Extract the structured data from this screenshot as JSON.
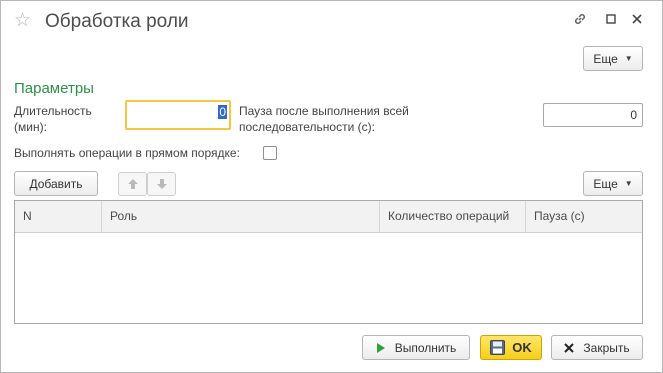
{
  "window": {
    "title": "Обработка роли",
    "icons": [
      "star-icon",
      "link-icon",
      "maximize-icon",
      "close-icon"
    ]
  },
  "toolbar": {
    "more_label": "Еще"
  },
  "params": {
    "section_title": "Параметры",
    "duration_label": "Длительность (мин):",
    "duration_value": "0",
    "pause_label": "Пауза после выполнения всей последовательности (с):",
    "pause_value": "0",
    "order_label": "Выполнять операции в прямом порядке:",
    "order_checked": false
  },
  "list_toolbar": {
    "add_label": "Добавить",
    "move_up_icon": "arrow-up-icon",
    "move_down_icon": "arrow-down-icon",
    "more_label": "Еще"
  },
  "table": {
    "columns": [
      "N",
      "Роль",
      "Количество операций",
      "Пауза (с)"
    ],
    "rows": []
  },
  "footer": {
    "run_label": "Выполнить",
    "ok_label": "OK",
    "close_label": "Закрыть"
  },
  "colors": {
    "section_title": "#2b9346",
    "focus_border": "#f4c742",
    "ok_button": "#f6cf1a",
    "run_icon": "#2aa23a"
  }
}
